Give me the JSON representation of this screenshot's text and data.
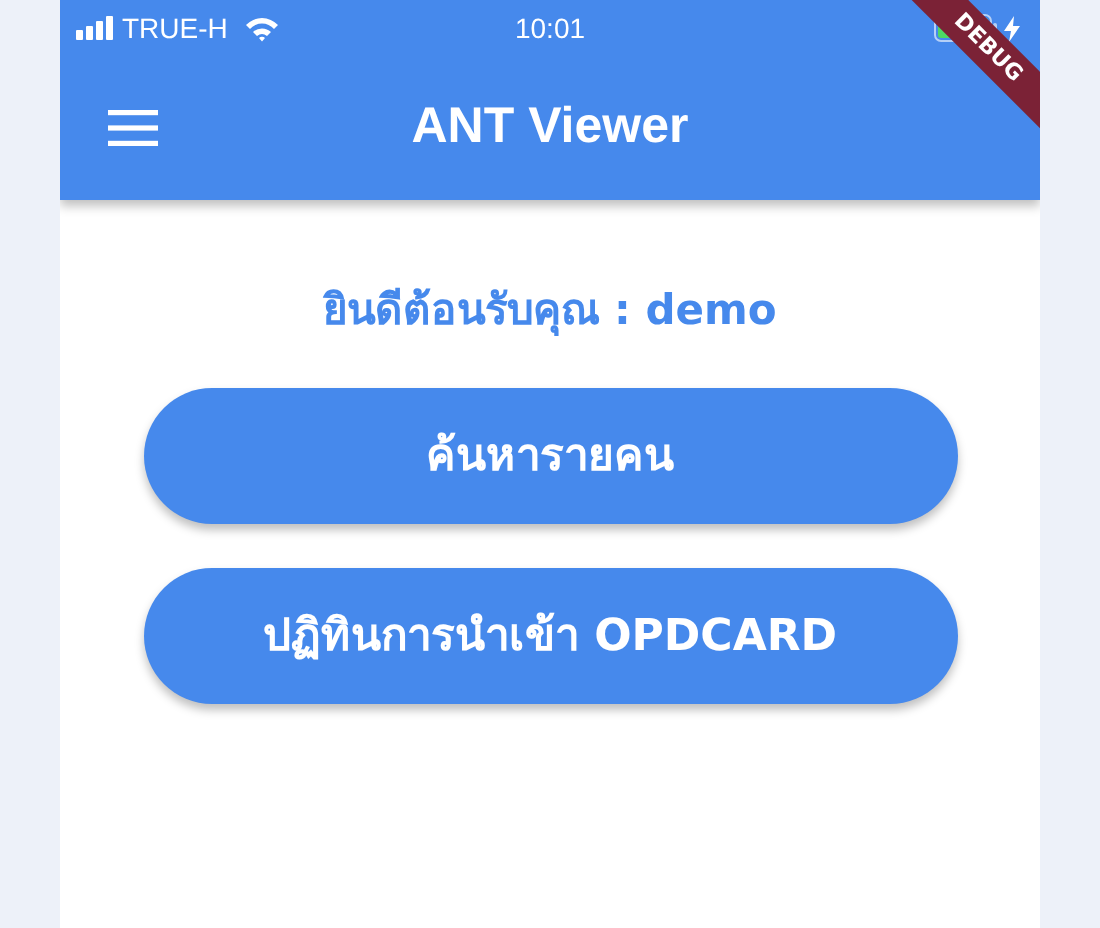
{
  "status_bar": {
    "carrier": "TRUE-H",
    "time": "10:01"
  },
  "debug_banner": {
    "label": "DEBUG"
  },
  "app_bar": {
    "title": "ANT Viewer"
  },
  "greeting": "ยินดีต้อนรับคุณ : demo",
  "buttons": [
    {
      "label": "ค้นหารายคน"
    },
    {
      "label": "ปฏิทินการนำเข้า OPDCARD"
    }
  ]
}
